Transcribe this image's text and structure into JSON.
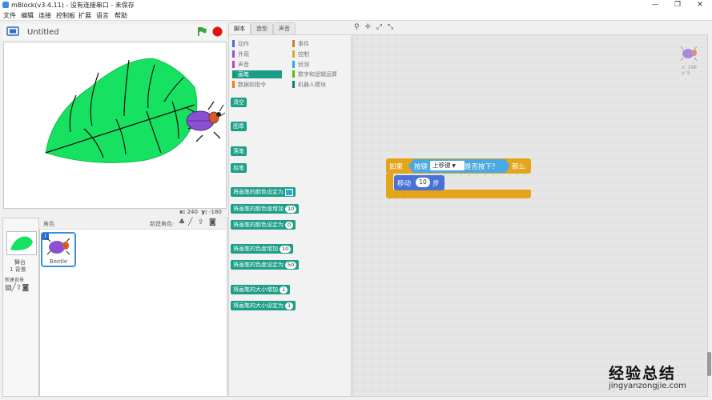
{
  "window": {
    "title": "mBlock(v3.4.11) - 没有连接串口 - 未保存",
    "buttons": [
      "—",
      "❐",
      "✕"
    ]
  },
  "menu": [
    "文件",
    "编辑",
    "连接",
    "控制板",
    "扩展",
    "语言",
    "帮助"
  ],
  "stage": {
    "project_name": "Untitled",
    "coords": {
      "x_label": "x:",
      "x": "240",
      "y_label": "y:",
      "y": "-180"
    }
  },
  "sprites": {
    "header": "角色",
    "new_sprite_label": "新建角色:",
    "stage_label": "舞台",
    "stage_backdrops": "1 背景",
    "new_backdrop_label": "新建背景",
    "items": [
      {
        "name": "Beetle",
        "info": "i"
      }
    ]
  },
  "palette": {
    "tabs": [
      "脚本",
      "造型",
      "声音"
    ],
    "categories_left": [
      "动作",
      "外观",
      "声音",
      "画笔",
      "数据和指令"
    ],
    "categories_right": [
      "事件",
      "控制",
      "侦测",
      "数字和逻辑运算",
      "机器人模块"
    ],
    "category_colors_left": [
      "#4a6cd4",
      "#8a55d7",
      "#bb42c3",
      "#0e9a6c",
      "#ee7d16"
    ],
    "category_colors_right": [
      "#c88330",
      "#e1a91a",
      "#2ca5e2",
      "#5cb712",
      "#0e7c7a"
    ],
    "selected_category": "画笔",
    "blocks": [
      {
        "text": "清空"
      },
      {
        "text": "图章"
      },
      {
        "text": "落笔"
      },
      {
        "text": "抬笔"
      },
      {
        "text": "将画笔的颜色设定为",
        "color": true
      },
      {
        "text": "将画笔的颜色值增加",
        "value": "10"
      },
      {
        "text": "将画笔的颜色设定为",
        "value": "0"
      },
      {
        "text": "将画笔的色度增加",
        "value": "10"
      },
      {
        "text": "将画笔的色度设定为",
        "value": "50"
      },
      {
        "text": "将画笔的大小增加",
        "value": "1"
      },
      {
        "text": "将画笔的大小设定为",
        "value": "1"
      }
    ]
  },
  "script": {
    "if_label": "如果",
    "key_label": "按键",
    "key_value": "上移键",
    "pressed_label": "是否按下？",
    "then_label": "那么",
    "move_label": "移动",
    "move_steps": "10",
    "steps_label": "步",
    "sprite_info": {
      "x": "x: 198",
      "y": "y: 9"
    }
  },
  "watermark": {
    "main": "经验总结",
    "sub": "jingyanzongjie.com"
  }
}
